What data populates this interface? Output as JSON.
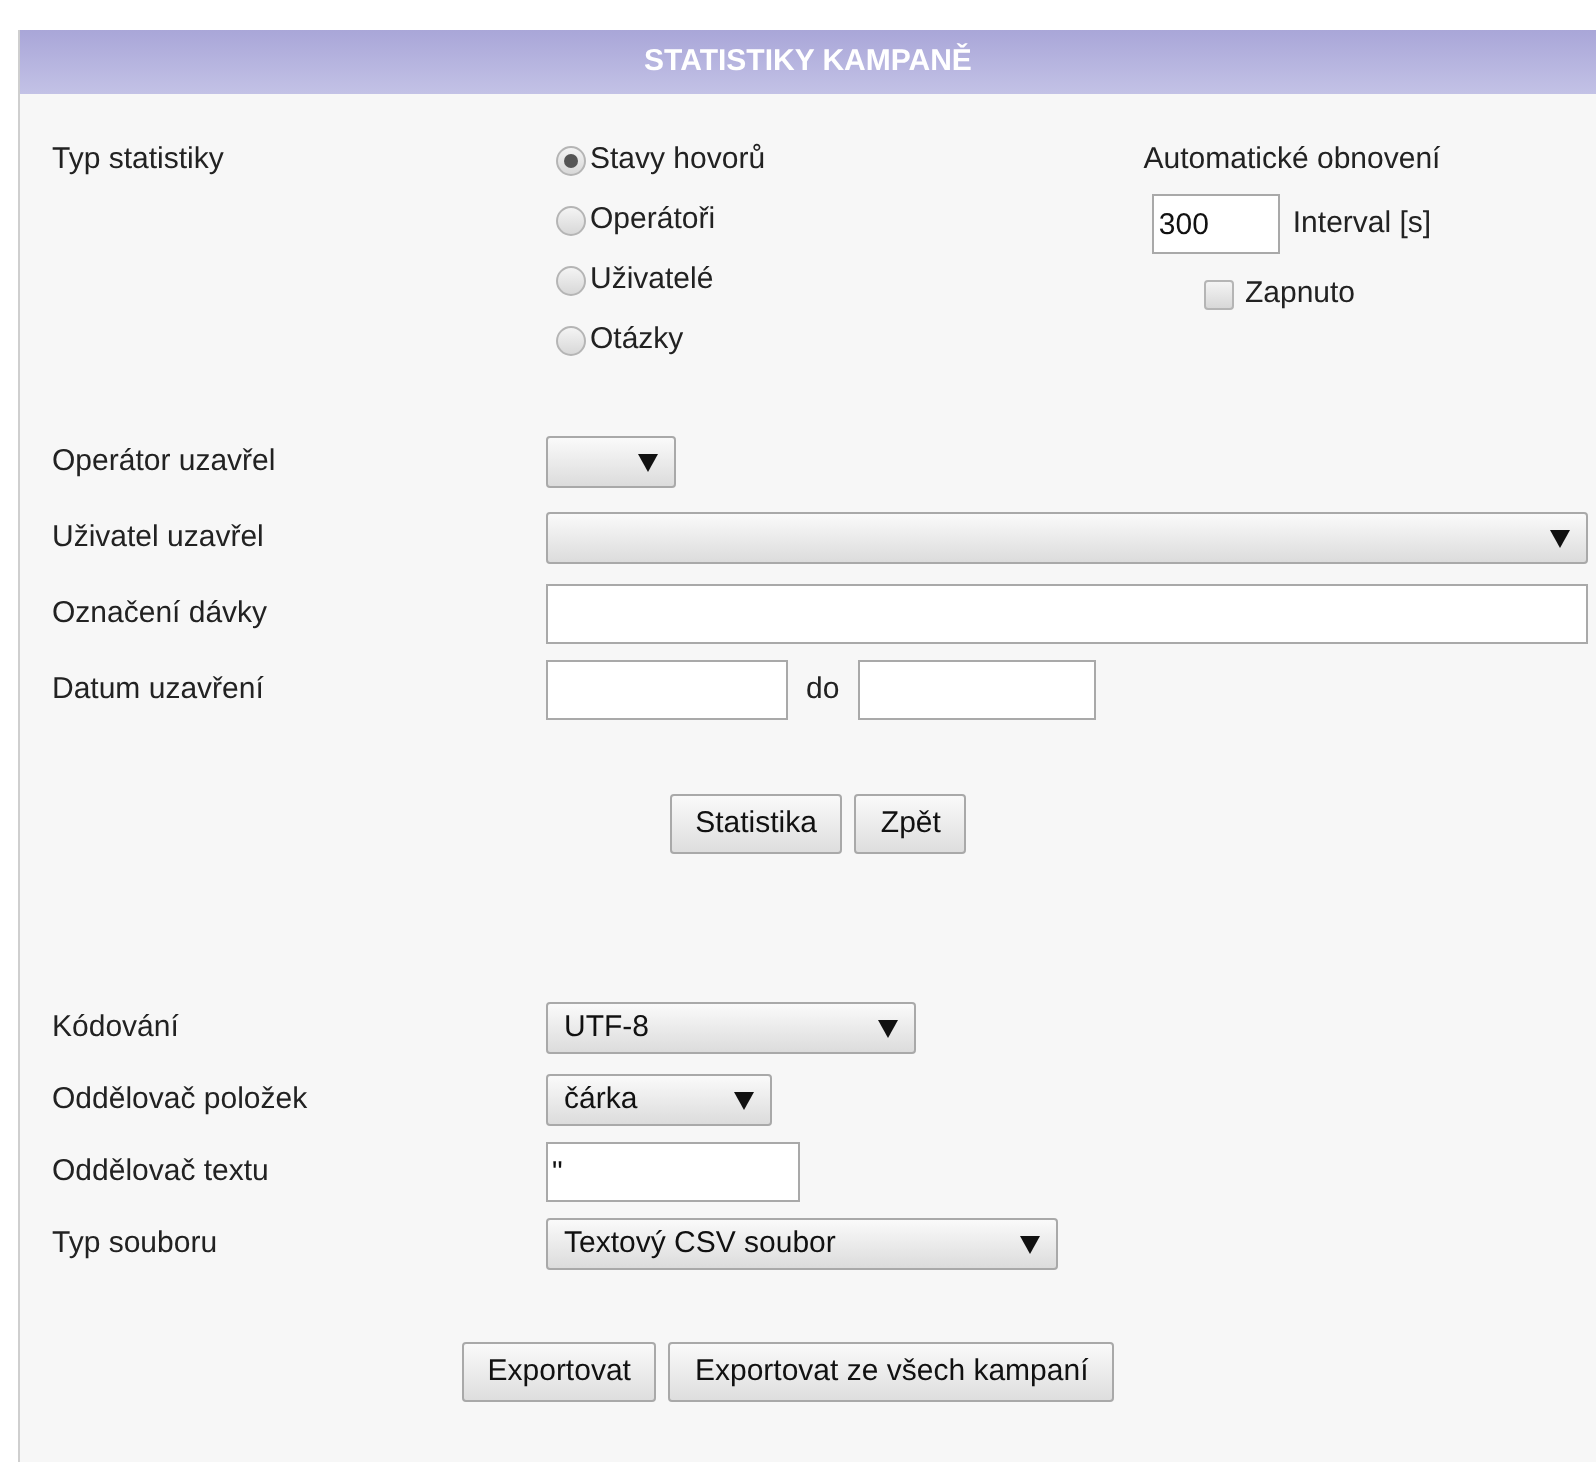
{
  "header": {
    "title": "STATISTIKY KAMPANĚ"
  },
  "stat_type": {
    "label": "Typ statistiky",
    "options": [
      {
        "label": "Stavy hovorů",
        "selected": true
      },
      {
        "label": "Operátoři",
        "selected": false
      },
      {
        "label": "Uživatelé",
        "selected": false
      },
      {
        "label": "Otázky",
        "selected": false
      }
    ]
  },
  "auto_refresh": {
    "title": "Automatické obnovení",
    "interval_value": "300",
    "interval_label": "Interval [s]",
    "enabled": {
      "label": "Zapnuto",
      "checked": false
    }
  },
  "filters": {
    "operator_closed": {
      "label": "Operátor uzavřel"
    },
    "user_closed": {
      "label": "Uživatel uzavřel"
    },
    "batch_label": {
      "label": "Označení dávky"
    },
    "closed_date": {
      "label": "Datum uzavření",
      "between": "do"
    }
  },
  "filter_buttons": [
    "Statistika",
    "Zpět"
  ],
  "export": {
    "encoding": {
      "label": "Kódování",
      "value": "UTF-8"
    },
    "item_separator": {
      "label": "Oddělovač položek",
      "value": "čárka"
    },
    "text_separator": {
      "label": "Oddělovač textu",
      "value": "\""
    },
    "file_type": {
      "label": "Typ souboru",
      "value": "Textový CSV soubor"
    }
  },
  "export_buttons": [
    "Exportovat",
    "Exportovat ze všech kampaní"
  ]
}
